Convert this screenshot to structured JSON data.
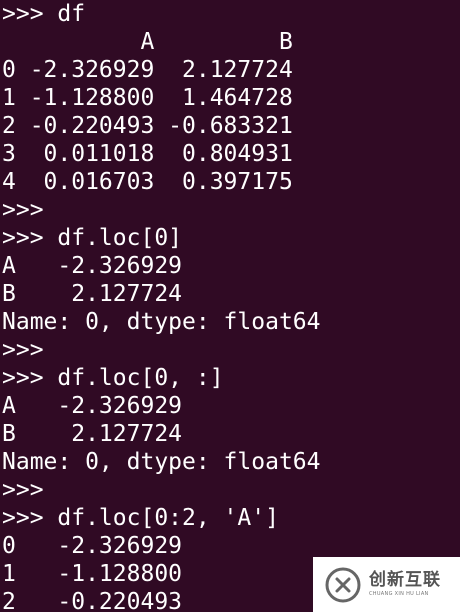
{
  "terminal": {
    "lines": [
      ">>> df",
      "          A         B",
      "0 -2.326929  2.127724",
      "1 -1.128800  1.464728",
      "2 -0.220493 -0.683321",
      "3  0.011018  0.804931",
      "4  0.016703  0.397175",
      ">>>",
      ">>> df.loc[0]",
      "A   -2.326929",
      "B    2.127724",
      "Name: 0, dtype: float64",
      ">>>",
      ">>> df.loc[0, :]",
      "A   -2.326929",
      "B    2.127724",
      "Name: 0, dtype: float64",
      ">>>",
      ">>> df.loc[0:2, 'A']",
      "0   -2.326929",
      "1   -1.128800",
      "2   -0.220493"
    ]
  },
  "watermark": {
    "name_cn": "创新互联",
    "name_en": "CHUANG XIN HU LIAN",
    "logo_icon": "cx-logo-icon"
  }
}
